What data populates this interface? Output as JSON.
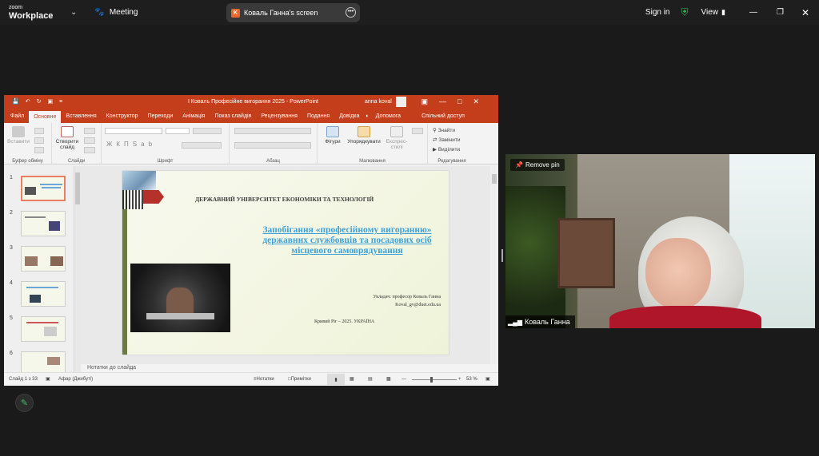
{
  "zoom": {
    "logo_small": "zoom",
    "logo_big": "Workplace",
    "meeting_label": "Meeting",
    "share_initial": "K",
    "share_label": "Коваль Ганна's screen",
    "sign_in": "Sign in",
    "view": "View"
  },
  "ppt": {
    "title": "I Коваль Професійне вигорання 2025 - PowerPoint",
    "user": "anna koval",
    "tabs": [
      "Файл",
      "Основне",
      "Вставлення",
      "Конструктор",
      "Переходи",
      "Анімація",
      "Показ слайдів",
      "Рецензування",
      "Подання",
      "Довідка",
      "Допомога",
      "Спільний доступ"
    ],
    "ribbon": {
      "paste": "Вставити",
      "new_slide": "Створити слайд",
      "figures": "Фігури",
      "arrange": "Упорядкувати",
      "express": "Експрес-стилі",
      "find": "Знайти",
      "replace": "Замінити",
      "select": "Виділити",
      "groups": [
        "Буфер обміну",
        "Слайди",
        "Шрифт",
        "Абзац",
        "Малювання",
        "Редагування"
      ]
    },
    "thumb_numbers": [
      "1",
      "2",
      "3",
      "4",
      "5",
      "6"
    ],
    "slide": {
      "university": "ДЕРЖАВНИЙ УНІВЕРСИТЕТ ЕКОНОМІКИ ТА ТЕХНОЛОГІЙ",
      "title": "Запобігання «професійному вигоранню» державних службовців та посадових осіб місцевого самоврядування",
      "author_line": "Укладач: професор Коваль Ганна",
      "email": "Koval_gv@duet.edu.ua",
      "city": "Кривий Ріг – 2025. УКРАЇНА"
    },
    "notes": "Нотатки до слайда",
    "status": {
      "slide": "Слайд 1 з 33",
      "lang": "Афар (Джибуті)",
      "notes_btn": "Нотатки",
      "comments_btn": "Примітки",
      "zoom": "53 %"
    }
  },
  "camera": {
    "remove_pin": "Remove pin",
    "name": "Коваль Ганна"
  }
}
